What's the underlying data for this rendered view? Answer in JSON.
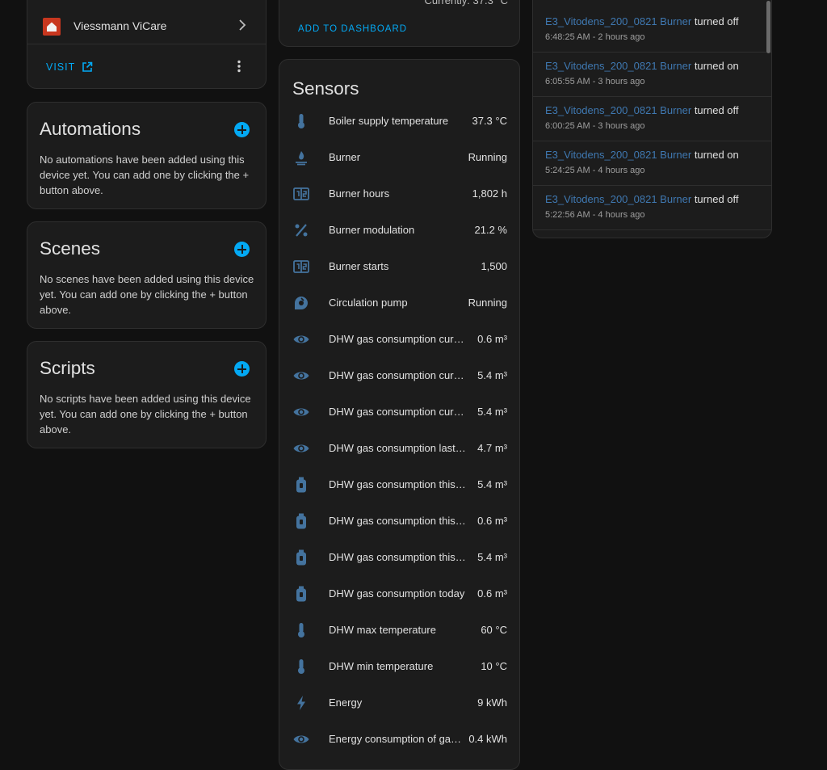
{
  "integration": {
    "name": "Viessmann ViCare",
    "visit_label": "VISIT"
  },
  "automations": {
    "title": "Automations",
    "description": "No automations have been added using this device yet. You can add one by clicking the + button above."
  },
  "scenes": {
    "title": "Scenes",
    "description": "No scenes have been added using this device yet. You can add one by clicking the + button above."
  },
  "scripts": {
    "title": "Scripts",
    "description": "No scripts have been added using this device yet. You can add one by clicking the + button above."
  },
  "dashboard": {
    "partial_text": "Currently: 37.3 °C",
    "add_label": "ADD TO DASHBOARD"
  },
  "sensors": {
    "title": "Sensors",
    "items": [
      {
        "name": "Boiler supply temperature",
        "value": "37.3 °C",
        "icon": "thermometer-icon"
      },
      {
        "name": "Burner",
        "value": "Running",
        "icon": "gas-burner-icon"
      },
      {
        "name": "Burner hours",
        "value": "1,802 h",
        "icon": "counter-icon"
      },
      {
        "name": "Burner modulation",
        "value": "21.2 %",
        "icon": "percent-icon"
      },
      {
        "name": "Burner starts",
        "value": "1,500",
        "icon": "counter-icon"
      },
      {
        "name": "Circulation pump",
        "value": "Running",
        "icon": "pump-icon"
      },
      {
        "name": "DHW gas consumption curr…",
        "value": "0.6 m³",
        "icon": "eye-icon"
      },
      {
        "name": "DHW gas consumption curr…",
        "value": "5.4 m³",
        "icon": "eye-icon"
      },
      {
        "name": "DHW gas consumption curr…",
        "value": "5.4 m³",
        "icon": "eye-icon"
      },
      {
        "name": "DHW gas consumption last …",
        "value": "4.7 m³",
        "icon": "eye-icon"
      },
      {
        "name": "DHW gas consumption this …",
        "value": "5.4 m³",
        "icon": "gas-cylinder-icon"
      },
      {
        "name": "DHW gas consumption this …",
        "value": "0.6 m³",
        "icon": "gas-cylinder-icon"
      },
      {
        "name": "DHW gas consumption this …",
        "value": "5.4 m³",
        "icon": "gas-cylinder-icon"
      },
      {
        "name": "DHW gas consumption today",
        "value": "0.6 m³",
        "icon": "gas-cylinder-icon"
      },
      {
        "name": "DHW max temperature",
        "value": "60 °C",
        "icon": "thermometer-icon"
      },
      {
        "name": "DHW min temperature",
        "value": "10 °C",
        "icon": "thermometer-icon"
      },
      {
        "name": "Energy",
        "value": "9 kWh",
        "icon": "lightning-icon"
      },
      {
        "name": "Energy consumption of ga…",
        "value": "0.4 kWh",
        "icon": "eye-icon"
      }
    ]
  },
  "logbook": {
    "entries": [
      {
        "entity": "E3_Vitodens_200_0821 Burner",
        "action": "turned off",
        "time": "6:48:25 AM - 2 hours ago"
      },
      {
        "entity": "E3_Vitodens_200_0821 Burner",
        "action": "turned on",
        "time": "6:05:55 AM - 3 hours ago"
      },
      {
        "entity": "E3_Vitodens_200_0821 Burner",
        "action": "turned off",
        "time": "6:00:25 AM - 3 hours ago"
      },
      {
        "entity": "E3_Vitodens_200_0821 Burner",
        "action": "turned on",
        "time": "5:24:25 AM - 4 hours ago"
      },
      {
        "entity": "E3_Vitodens_200_0821 Burner",
        "action": "turned off",
        "time": "5:22:56 AM - 4 hours ago"
      }
    ]
  },
  "colors": {
    "accent": "#03a9f4",
    "entity_link": "#3f78b1",
    "icon": "#44739e",
    "card_bg": "#1c1c1c",
    "page_bg": "#111111"
  }
}
